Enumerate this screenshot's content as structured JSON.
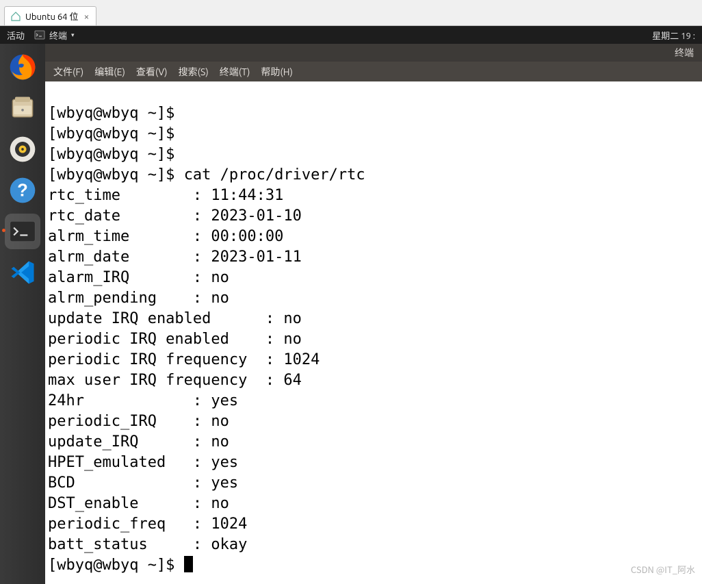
{
  "vm_tab": {
    "label": "Ubuntu 64 位"
  },
  "topbar": {
    "activities": "活动",
    "app": "终端",
    "clock": "星期二 19 :"
  },
  "term_title": "终端",
  "menus": {
    "file": "文件(F)",
    "edit": "编辑(E)",
    "view": "查看(V)",
    "search": "搜索(S)",
    "terminal": "终端(T)",
    "help": "帮助(H)"
  },
  "prompt": "[wbyq@wbyq ~]$ ",
  "command": "cat /proc/driver/rtc",
  "output": {
    "rtc_time": {
      "label": "rtc_time        : ",
      "value": "11:44:31"
    },
    "rtc_date": {
      "label": "rtc_date        : ",
      "value": "2023-01-10"
    },
    "alrm_time": {
      "label": "alrm_time       : ",
      "value": "00:00:00"
    },
    "alrm_date": {
      "label": "alrm_date       : ",
      "value": "2023-01-11"
    },
    "alarm_IRQ": {
      "label": "alarm_IRQ       : ",
      "value": "no"
    },
    "alrm_pending": {
      "label": "alrm_pending    : ",
      "value": "no"
    },
    "update_IRQ_en": {
      "label": "update IRQ enabled      : ",
      "value": "no"
    },
    "periodic_IRQ_en": {
      "label": "periodic IRQ enabled    : ",
      "value": "no"
    },
    "periodic_freq": {
      "label": "periodic IRQ frequency  : ",
      "value": "1024"
    },
    "max_user_freq": {
      "label": "max user IRQ frequency  : ",
      "value": "64"
    },
    "twentyfour": {
      "label": "24hr            : ",
      "value": "yes"
    },
    "periodic_IRQ": {
      "label": "periodic_IRQ    : ",
      "value": "no"
    },
    "update_IRQ": {
      "label": "update_IRQ      : ",
      "value": "no"
    },
    "HPET_emulated": {
      "label": "HPET_emulated   : ",
      "value": "yes"
    },
    "BCD": {
      "label": "BCD             : ",
      "value": "yes"
    },
    "DST_enable": {
      "label": "DST_enable      : ",
      "value": "no"
    },
    "periodic_freq2": {
      "label": "periodic_freq   : ",
      "value": "1024"
    },
    "batt_status": {
      "label": "batt_status     : ",
      "value": "okay"
    }
  },
  "watermark": "CSDN @IT_阿水"
}
